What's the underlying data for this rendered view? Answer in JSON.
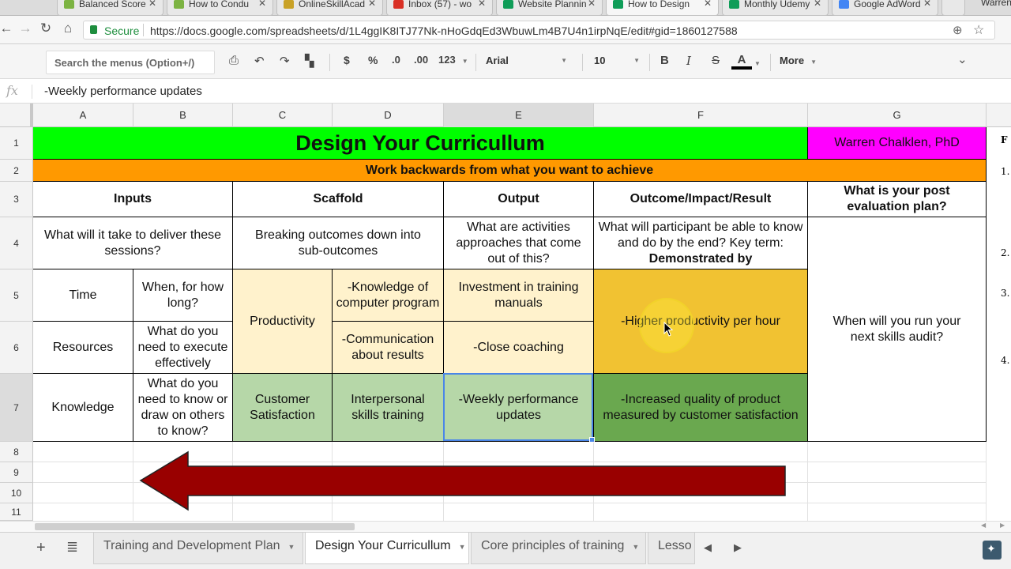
{
  "browser": {
    "tabs": [
      {
        "title": "Balanced Score",
        "color": "#7cb342"
      },
      {
        "title": "How to Condu",
        "color": "#7cb342"
      },
      {
        "title": "OnlineSkillAcad",
        "color": "#c9a227"
      },
      {
        "title": "Inbox (57) - wo",
        "color": "#d93025"
      },
      {
        "title": "Website Plannin",
        "color": "#0f9d58"
      },
      {
        "title": "How to Design",
        "color": "#0f9d58"
      },
      {
        "title": "Monthly Udemy",
        "color": "#0f9d58"
      },
      {
        "title": "Google AdWord",
        "color": "#4285f4"
      }
    ],
    "overflow_tab": "Warren",
    "secure_label": "Secure",
    "url": "https://docs.google.com/spreadsheets/d/1L4ggIK8ITJ77Nk-nHoGdqEd3WbuwLm4B7U4n1irpNqE/edit#gid=1860127588"
  },
  "toolbar": {
    "search_placeholder": "Search the menus (Option+/)",
    "currency": "$",
    "percent": "%",
    "dec_less": ".0",
    "dec_more": ".00",
    "format_more": "123",
    "font": "Arial",
    "font_size": "10",
    "bold": "B",
    "italic": "I",
    "strike": "S",
    "text_color": "A",
    "more": "More"
  },
  "formula_bar": {
    "fx": "fx",
    "value": "-Weekly performance updates"
  },
  "grid": {
    "columns": [
      "A",
      "B",
      "C",
      "D",
      "E",
      "F",
      "G"
    ],
    "rows": [
      "1",
      "2",
      "3",
      "4",
      "5",
      "6",
      "7",
      "8",
      "9",
      "10",
      "11"
    ],
    "title": "Design Your Curricullum",
    "author": "Warren Chalklen, PhD",
    "subtitle": "Work backwards from what you want to achieve",
    "headers": {
      "inputs": "Inputs",
      "scaffold": "Scaffold",
      "output": "Output",
      "outcome": "Outcome/Impact/Result",
      "post_eval": "What is your post evaluation plan?"
    },
    "row4": {
      "inputs": "What will it take to deliver these sessions?",
      "scaffold": "Breaking outcomes down into sub-outcomes",
      "output": "What are activities approaches that come out of this?",
      "outcome_text": "What will participant be able to know and do by the end? Key term:",
      "outcome_bold": "Demonstrated by"
    },
    "row5": {
      "a": "Time",
      "b": "When, for how long?",
      "d": "-Knowledge of computer program",
      "e": "Investment in training manuals"
    },
    "productivity": "Productivity",
    "higher_productivity": "-Higher productivity per hour",
    "skills_audit": "When will you run your next skills audit?",
    "row6": {
      "a": "Resources",
      "b": "What do you need to execute effectively",
      "d": "-Communication about results",
      "e": "-Close coaching"
    },
    "row7": {
      "a": "Knowledge",
      "b": "What do you need to know or draw on others to know?",
      "c": "Customer Satisfaction",
      "d": "Interpersonal skills training",
      "e": "-Weekly performance updates",
      "f": "-Increased quality of product measured by customer satisfaction"
    },
    "side_letter": "F",
    "side_numbers": [
      "1.",
      "2.",
      "3.",
      "4."
    ]
  },
  "colors": {
    "title_bg": "#00ff00",
    "author_bg": "#ff00ff",
    "subtitle_bg": "#ff9900",
    "scaffold_bg": "#fff2cc",
    "outcome_bg": "#f1c232",
    "green_light": "#b6d7a8",
    "green_dark": "#6aa84f",
    "arrow": "#990000"
  },
  "sheets": [
    {
      "name": "Training and Development Plan"
    },
    {
      "name": "Design Your Curricullum"
    },
    {
      "name": "Core principles of training"
    },
    {
      "name": "Lesso"
    }
  ]
}
